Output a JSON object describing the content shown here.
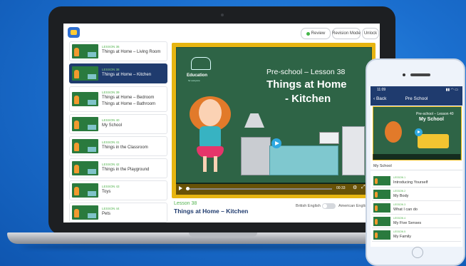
{
  "app": {
    "buttons": {
      "review": "Review",
      "revision_mode": "Revision Mode",
      "unlock": "Unlock"
    }
  },
  "lessons": [
    {
      "lesson": "LESSON 36",
      "title": "Things at Home – Living Room",
      "title2": ""
    },
    {
      "lesson": "LESSON 38",
      "title": "Things at Home – Kitchen",
      "title2": ""
    },
    {
      "lesson": "LESSON 39",
      "title": "Things at Home – Bedroom",
      "title2": "Things at Home – Bathroom"
    },
    {
      "lesson": "LESSON 40",
      "title": "My School",
      "title2": ""
    },
    {
      "lesson": "LESSON 41",
      "title": "Things in the Classroom",
      "title2": ""
    },
    {
      "lesson": "LESSON 42",
      "title": "Things in the Playground",
      "title2": ""
    },
    {
      "lesson": "LESSON 43",
      "title": "Toys",
      "title2": ""
    },
    {
      "lesson": "LESSON 44",
      "title": "Pets",
      "title2": ""
    }
  ],
  "video": {
    "brand": "Education",
    "brand_sub": "for everyone",
    "subtitle": "Pre-school – Lesson 38",
    "title_line1": "Things at Home",
    "title_line2": "- Kitchen",
    "time": "00:33",
    "gear_icon": "⚙",
    "fullscreen_icon": "⤢"
  },
  "current": {
    "lesson": "Lesson 38",
    "title": "Things at Home – Kitchen",
    "lang_left": "British English",
    "lang_right": "American English"
  },
  "phone": {
    "time": "11:09",
    "signal": "▮▮ ◠ ▭",
    "back": "‹ Back",
    "nav_title": "Pre School",
    "video_subtitle": "Pre-school – Lesson 40",
    "video_title": "My School",
    "section": "My School",
    "items": [
      {
        "lesson": "LESSON 1",
        "title": "Introducing Yourself"
      },
      {
        "lesson": "LESSON 2",
        "title": "My Body"
      },
      {
        "lesson": "LESSON 3",
        "title": "What I can do"
      },
      {
        "lesson": "LESSON 4",
        "title": "My Five Senses"
      },
      {
        "lesson": "LESSON 5",
        "title": "My Family"
      }
    ]
  }
}
